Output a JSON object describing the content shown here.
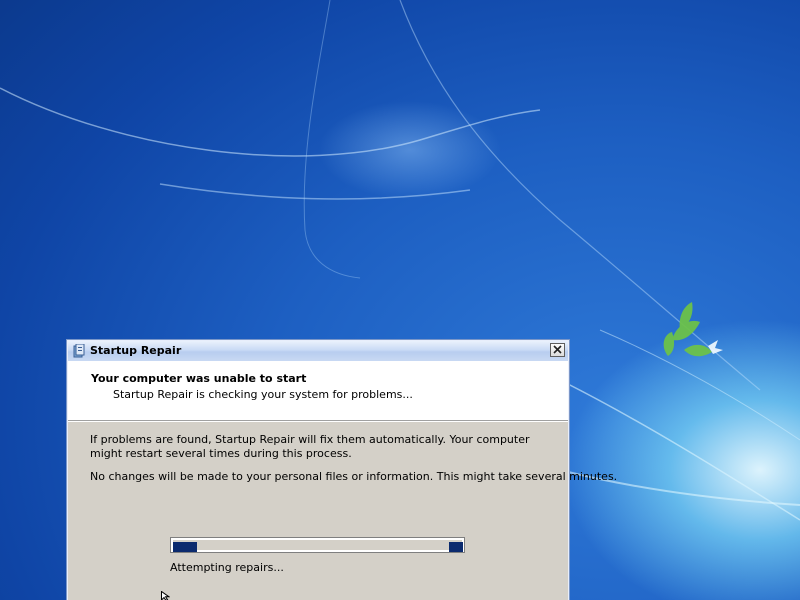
{
  "desktop": {
    "accent": "#1d5fc2"
  },
  "window": {
    "title": "Startup Repair",
    "icon": "startup-repair-icon",
    "close_icon": "close-icon",
    "header": {
      "title": "Your computer was unable to start",
      "subtitle": "Startup Repair is checking your system for problems..."
    },
    "body": {
      "paragraph1": "If problems are found, Startup Repair will fix them automatically. Your computer might restart several times during this process.",
      "paragraph2": "No changes will be made to your personal files or information. This might take several minutes."
    },
    "progress": {
      "status": "Attempting repairs...",
      "style": "marquee",
      "color": "#0b2a6e"
    }
  }
}
